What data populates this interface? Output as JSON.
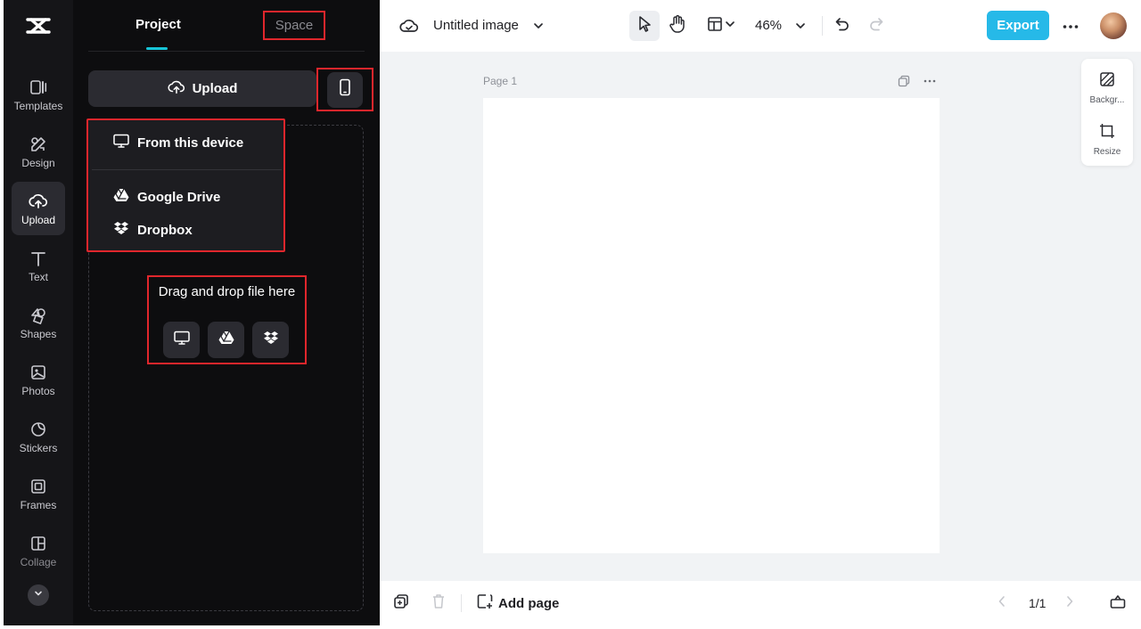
{
  "rail": {
    "items": [
      {
        "label": "Templates",
        "icon": "templates-icon"
      },
      {
        "label": "Design",
        "icon": "design-icon"
      },
      {
        "label": "Upload",
        "icon": "cloud-upload-icon",
        "active": true
      },
      {
        "label": "Text",
        "icon": "text-icon"
      },
      {
        "label": "Shapes",
        "icon": "shapes-icon"
      },
      {
        "label": "Photos",
        "icon": "photos-icon"
      },
      {
        "label": "Stickers",
        "icon": "stickers-icon"
      },
      {
        "label": "Frames",
        "icon": "frames-icon"
      },
      {
        "label": "Collage",
        "icon": "collage-icon"
      }
    ]
  },
  "panel": {
    "tabs": {
      "project": "Project",
      "space": "Space"
    },
    "upload_label": "Upload",
    "menu": {
      "from_device": "From this device",
      "google_drive": "Google Drive",
      "dropbox": "Dropbox"
    },
    "drop_text": "Drag and drop file here"
  },
  "topbar": {
    "title": "Untitled image",
    "zoom": "46%",
    "export_label": "Export"
  },
  "canvas": {
    "page_label": "Page 1",
    "side_tools": {
      "background": "Backgr...",
      "resize": "Resize"
    }
  },
  "bottombar": {
    "add_page": "Add page",
    "page_count": "1/1"
  },
  "colors": {
    "accent": "#26b9e8",
    "tab_indicator": "#17c5d8",
    "annotation_box": "#e0262c"
  }
}
